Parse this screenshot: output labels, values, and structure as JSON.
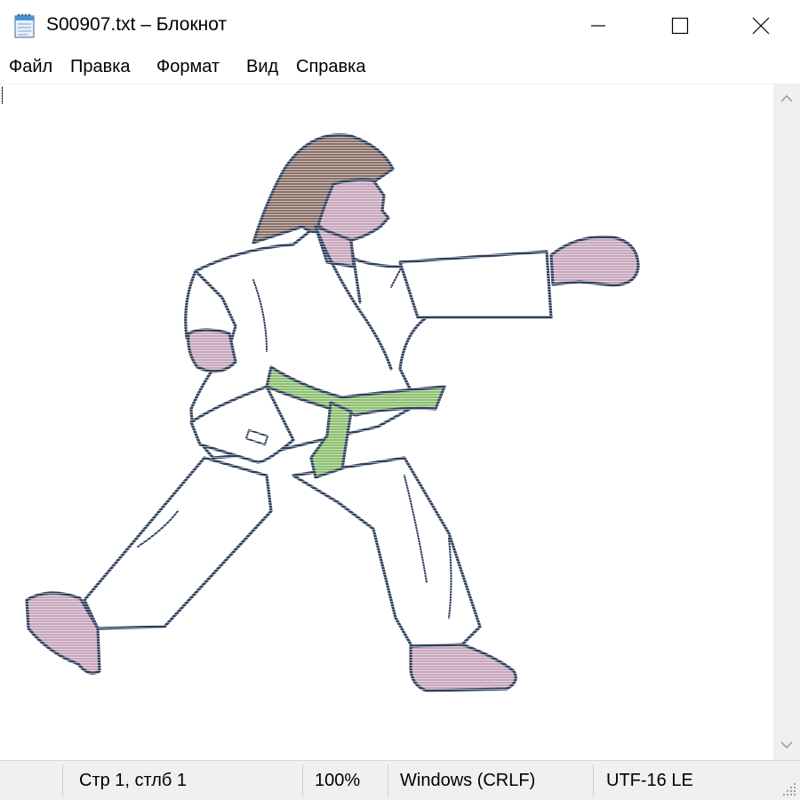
{
  "window": {
    "title": "S00907.txt – Блокнот",
    "icons": {
      "app": "notepad-icon",
      "minimize": "minimize-icon",
      "maximize": "maximize-icon",
      "close": "close-icon"
    }
  },
  "menu": {
    "items": [
      {
        "label": "Файл"
      },
      {
        "label": "Правка"
      },
      {
        "label": "Формат"
      },
      {
        "label": "Вид"
      },
      {
        "label": "Справка"
      }
    ]
  },
  "editor": {
    "content_icon": "karate-figure-ascii-art",
    "colors": {
      "outline": "#2c3e5a",
      "hair": "#8a7168",
      "skin": "#c7a5bd",
      "belt": "#8bbf6e",
      "gi": "#ffffff"
    }
  },
  "status": {
    "position": "Стр 1, стлб 1",
    "zoom": "100%",
    "line_endings": "Windows (CRLF)",
    "encoding": "UTF-16 LE"
  }
}
